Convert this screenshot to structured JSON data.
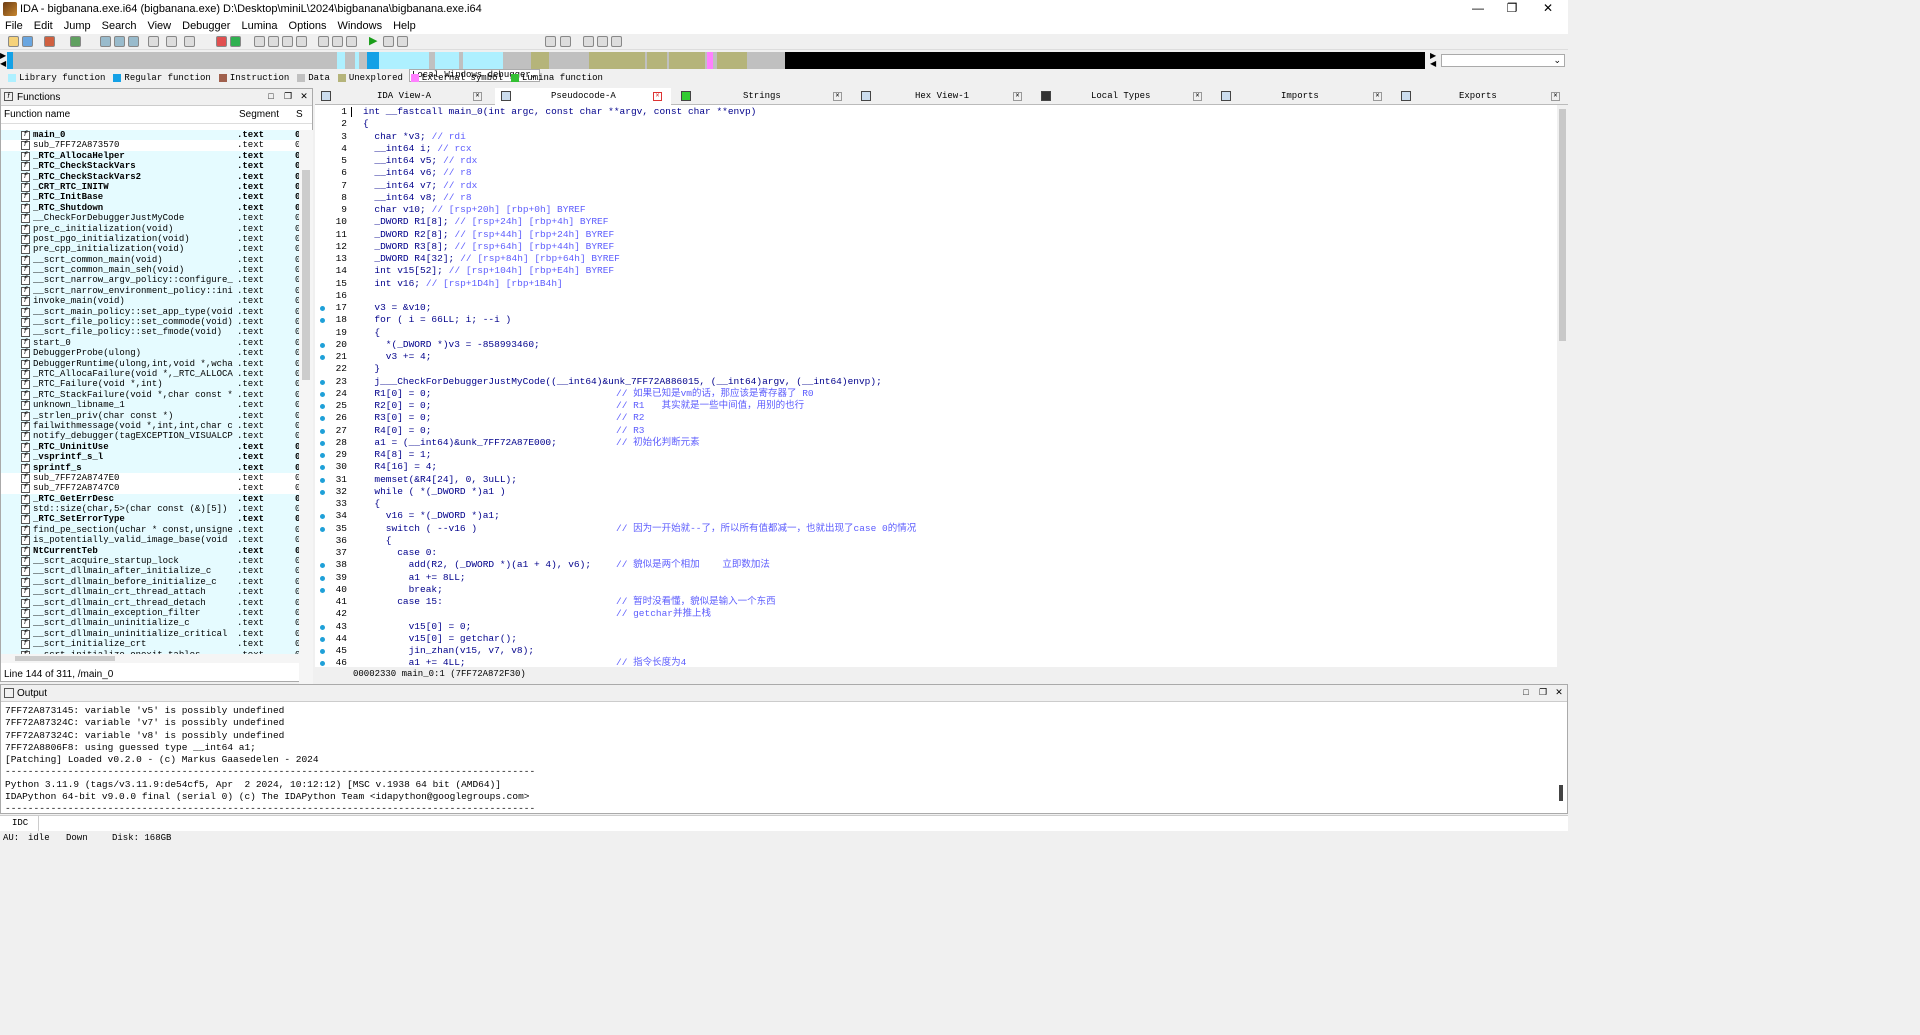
{
  "window": {
    "title": "IDA - bigbanana.exe.i64 (bigbanana.exe) D:\\Desktop\\miniL\\2024\\bigbanana\\bigbanana.exe.i64"
  },
  "menu": [
    "File",
    "Edit",
    "Jump",
    "Search",
    "View",
    "Debugger",
    "Lumina",
    "Options",
    "Windows",
    "Help"
  ],
  "toolbar": {
    "debugger": "Local Windows debugger"
  },
  "legend": [
    {
      "label": "Library function",
      "color": "#aef0ff"
    },
    {
      "label": "Regular function",
      "color": "#14a1e6"
    },
    {
      "label": "Instruction",
      "color": "#a0604d"
    },
    {
      "label": "Data",
      "color": "#c0c0c0"
    },
    {
      "label": "Unexplored",
      "color": "#b5b47a"
    },
    {
      "label": "External symbol",
      "color": "#ff80ff"
    },
    {
      "label": "Lumina function",
      "color": "#33c033"
    }
  ],
  "functions": {
    "title": "Functions",
    "col_name": "Function name",
    "col_segment": "Segment",
    "col_s": "S",
    "status": "Line 144 of 311, /main_0",
    "rows": [
      {
        "name": "main_0",
        "seg": ".text",
        "c": "0",
        "hl": true,
        "cy": true
      },
      {
        "name": "sub_7FF72A873570",
        "seg": ".text",
        "c": "0",
        "hl": false,
        "cy": false
      },
      {
        "name": "_RTC_AllocaHelper",
        "seg": ".text",
        "c": "0",
        "hl": true,
        "cy": true
      },
      {
        "name": "_RTC_CheckStackVars",
        "seg": ".text",
        "c": "0",
        "hl": true,
        "cy": true
      },
      {
        "name": "_RTC_CheckStackVars2",
        "seg": ".text",
        "c": "0",
        "hl": true,
        "cy": true
      },
      {
        "name": "_CRT_RTC_INITW",
        "seg": ".text",
        "c": "0",
        "hl": true,
        "cy": true
      },
      {
        "name": "_RTC_InitBase",
        "seg": ".text",
        "c": "0",
        "hl": true,
        "cy": true
      },
      {
        "name": "_RTC_Shutdown",
        "seg": ".text",
        "c": "0",
        "hl": true,
        "cy": true
      },
      {
        "name": "__CheckForDebuggerJustMyCode",
        "seg": ".text",
        "c": "0",
        "hl": false,
        "cy": true
      },
      {
        "name": "pre_c_initialization(void)",
        "seg": ".text",
        "c": "0",
        "hl": false,
        "cy": true
      },
      {
        "name": "post_pgo_initialization(void)",
        "seg": ".text",
        "c": "0",
        "hl": false,
        "cy": true
      },
      {
        "name": "pre_cpp_initialization(void)",
        "seg": ".text",
        "c": "0",
        "hl": false,
        "cy": true
      },
      {
        "name": "__scrt_common_main(void)",
        "seg": ".text",
        "c": "0",
        "hl": false,
        "cy": true
      },
      {
        "name": "__scrt_common_main_seh(void)",
        "seg": ".text",
        "c": "0",
        "hl": false,
        "cy": true
      },
      {
        "name": "__scrt_narrow_argv_policy::configure_a…",
        "seg": ".text",
        "c": "0",
        "hl": false,
        "cy": true
      },
      {
        "name": "__scrt_narrow_environment_policy::init…",
        "seg": ".text",
        "c": "0",
        "hl": false,
        "cy": true
      },
      {
        "name": "invoke_main(void)",
        "seg": ".text",
        "c": "0",
        "hl": false,
        "cy": true
      },
      {
        "name": "__scrt_main_policy::set_app_type(void)",
        "seg": ".text",
        "c": "0",
        "hl": false,
        "cy": true
      },
      {
        "name": "__scrt_file_policy::set_commode(void)",
        "seg": ".text",
        "c": "0",
        "hl": false,
        "cy": true
      },
      {
        "name": "__scrt_file_policy::set_fmode(void)",
        "seg": ".text",
        "c": "0",
        "hl": false,
        "cy": true
      },
      {
        "name": "start_0",
        "seg": ".text",
        "c": "0",
        "hl": false,
        "cy": true
      },
      {
        "name": "DebuggerProbe(ulong)",
        "seg": ".text",
        "c": "0",
        "hl": false,
        "cy": true
      },
      {
        "name": "DebuggerRuntime(ulong,int,void *,wchar…",
        "seg": ".text",
        "c": "0",
        "hl": false,
        "cy": true
      },
      {
        "name": "_RTC_AllocaFailure(void *,_RTC_ALLOCA_…",
        "seg": ".text",
        "c": "0",
        "hl": false,
        "cy": true
      },
      {
        "name": "_RTC_Failure(void *,int)",
        "seg": ".text",
        "c": "0",
        "hl": false,
        "cy": true
      },
      {
        "name": "_RTC_StackFailure(void *,char const *)",
        "seg": ".text",
        "c": "0",
        "hl": false,
        "cy": true
      },
      {
        "name": "unknown_libname_1",
        "seg": ".text",
        "c": "0",
        "hl": false,
        "cy": true
      },
      {
        "name": "_strlen_priv(char const *)",
        "seg": ".text",
        "c": "0",
        "hl": false,
        "cy": true
      },
      {
        "name": "failwithmessage(void *,int,int,char co…",
        "seg": ".text",
        "c": "0",
        "hl": false,
        "cy": true
      },
      {
        "name": "notify_debugger(tagEXCEPTION_VISUALCPP…",
        "seg": ".text",
        "c": "0",
        "hl": false,
        "cy": true
      },
      {
        "name": "_RTC_UninitUse",
        "seg": ".text",
        "c": "0",
        "hl": true,
        "cy": true
      },
      {
        "name": "_vsprintf_s_l",
        "seg": ".text",
        "c": "0",
        "hl": true,
        "cy": true
      },
      {
        "name": "sprintf_s",
        "seg": ".text",
        "c": "0",
        "hl": true,
        "cy": true
      },
      {
        "name": "sub_7FF72A8747E0",
        "seg": ".text",
        "c": "0",
        "hl": false,
        "cy": false
      },
      {
        "name": "sub_7FF72A8747C0",
        "seg": ".text",
        "c": "0",
        "hl": false,
        "cy": false
      },
      {
        "name": "_RTC_GetErrDesc",
        "seg": ".text",
        "c": "0",
        "hl": true,
        "cy": true
      },
      {
        "name": "std::size(char,5>(char const (&)[5])",
        "seg": ".text",
        "c": "0",
        "hl": false,
        "cy": true
      },
      {
        "name": "_RTC_SetErrorType",
        "seg": ".text",
        "c": "0",
        "hl": true,
        "cy": true
      },
      {
        "name": "find_pe_section(uchar * const,unsigned…",
        "seg": ".text",
        "c": "0",
        "hl": false,
        "cy": true
      },
      {
        "name": "is_potentially_valid_image_base(void *…",
        "seg": ".text",
        "c": "0",
        "hl": false,
        "cy": true
      },
      {
        "name": "NtCurrentTeb",
        "seg": ".text",
        "c": "0",
        "hl": true,
        "cy": true
      },
      {
        "name": "__scrt_acquire_startup_lock",
        "seg": ".text",
        "c": "0",
        "hl": false,
        "cy": true
      },
      {
        "name": "__scrt_dllmain_after_initialize_c",
        "seg": ".text",
        "c": "0",
        "hl": false,
        "cy": true
      },
      {
        "name": "__scrt_dllmain_before_initialize_c",
        "seg": ".text",
        "c": "0",
        "hl": false,
        "cy": true
      },
      {
        "name": "__scrt_dllmain_crt_thread_attach",
        "seg": ".text",
        "c": "0",
        "hl": false,
        "cy": true
      },
      {
        "name": "__scrt_dllmain_crt_thread_detach",
        "seg": ".text",
        "c": "0",
        "hl": false,
        "cy": true
      },
      {
        "name": "__scrt_dllmain_exception_filter",
        "seg": ".text",
        "c": "0",
        "hl": false,
        "cy": true
      },
      {
        "name": "__scrt_dllmain_uninitialize_c",
        "seg": ".text",
        "c": "0",
        "hl": false,
        "cy": true
      },
      {
        "name": "__scrt_dllmain_uninitialize_critical",
        "seg": ".text",
        "c": "0",
        "hl": false,
        "cy": true
      },
      {
        "name": "__scrt_initialize_crt",
        "seg": ".text",
        "c": "0",
        "hl": false,
        "cy": true
      },
      {
        "name": "__scrt_initialize_onexit_tables",
        "seg": ".text",
        "c": "0",
        "hl": false,
        "cy": true
      }
    ]
  },
  "tabs": [
    {
      "label": "IDA View-A",
      "active": false
    },
    {
      "label": "Pseudocode-A",
      "active": true
    },
    {
      "label": "Strings",
      "active": false
    },
    {
      "label": "Hex View-1",
      "active": false
    },
    {
      "label": "Local Types",
      "active": false
    },
    {
      "label": "Imports",
      "active": false
    },
    {
      "label": "Exports",
      "active": false
    }
  ],
  "code": {
    "status": "00002330 main_0:1 (7FF72A872F30)",
    "lines": [
      {
        "n": "1",
        "t": "int __fastcall main_0(int argc, const char **argv, const char **envp)",
        "c": "",
        "dot": false
      },
      {
        "n": "2",
        "t": "{",
        "c": "",
        "dot": false
      },
      {
        "n": "3",
        "t": "  char *v3; ",
        "c": "// rdi",
        "dot": false
      },
      {
        "n": "4",
        "t": "  __int64 i; ",
        "c": "// rcx",
        "dot": false
      },
      {
        "n": "5",
        "t": "  __int64 v5; ",
        "c": "// rdx",
        "dot": false
      },
      {
        "n": "6",
        "t": "  __int64 v6; ",
        "c": "// r8",
        "dot": false
      },
      {
        "n": "7",
        "t": "  __int64 v7; ",
        "c": "// rdx",
        "dot": false
      },
      {
        "n": "8",
        "t": "  __int64 v8; ",
        "c": "// r8",
        "dot": false
      },
      {
        "n": "9",
        "t": "  char v10; ",
        "c": "// [rsp+20h] [rbp+0h] BYREF",
        "dot": false
      },
      {
        "n": "10",
        "t": "  _DWORD R1[8]; ",
        "c": "// [rsp+24h] [rbp+4h] BYREF",
        "dot": false
      },
      {
        "n": "11",
        "t": "  _DWORD R2[8]; ",
        "c": "// [rsp+44h] [rbp+24h] BYREF",
        "dot": false
      },
      {
        "n": "12",
        "t": "  _DWORD R3[8]; ",
        "c": "// [rsp+64h] [rbp+44h] BYREF",
        "dot": false
      },
      {
        "n": "13",
        "t": "  _DWORD R4[32]; ",
        "c": "// [rsp+84h] [rbp+64h] BYREF",
        "dot": false
      },
      {
        "n": "14",
        "t": "  int v15[52]; ",
        "c": "// [rsp+104h] [rbp+E4h] BYREF",
        "dot": false
      },
      {
        "n": "15",
        "t": "  int v16; ",
        "c": "// [rsp+1D4h] [rbp+1B4h]",
        "dot": false
      },
      {
        "n": "16",
        "t": "",
        "c": "",
        "dot": false
      },
      {
        "n": "17",
        "t": "  v3 = &v10;",
        "c": "",
        "dot": true
      },
      {
        "n": "18",
        "t": "  for ( i = 66LL; i; --i )",
        "c": "",
        "dot": true
      },
      {
        "n": "19",
        "t": "  {",
        "c": "",
        "dot": false
      },
      {
        "n": "20",
        "t": "    *(_DWORD *)v3 = -858993460;",
        "c": "",
        "dot": true
      },
      {
        "n": "21",
        "t": "    v3 += 4;",
        "c": "",
        "dot": true
      },
      {
        "n": "22",
        "t": "  }",
        "c": "",
        "dot": false
      },
      {
        "n": "23",
        "t": "  j___CheckForDebuggerJustMyCode((__int64)&unk_7FF72A886015, (__int64)argv, (__int64)envp);",
        "c": "",
        "dot": true
      },
      {
        "n": "24",
        "t": "  R1[0] = 0;",
        "c": "// 如果已知是vm的话，那应该是寄存器了 R0",
        "dot": true
      },
      {
        "n": "25",
        "t": "  R2[0] = 0;",
        "c": "// R1   其实就是一些中间值，用别的也行",
        "dot": true
      },
      {
        "n": "26",
        "t": "  R3[0] = 0;",
        "c": "// R2",
        "dot": true
      },
      {
        "n": "27",
        "t": "  R4[0] = 0;",
        "c": "// R3",
        "dot": true
      },
      {
        "n": "28",
        "t": "  a1 = (__int64)&unk_7FF72A87E000;",
        "c": "// 初始化判断元素",
        "dot": true
      },
      {
        "n": "29",
        "t": "  R4[8] = 1;",
        "c": "",
        "dot": true
      },
      {
        "n": "30",
        "t": "  R4[16] = 4;",
        "c": "",
        "dot": true
      },
      {
        "n": "31",
        "t": "  memset(&R4[24], 0, 3uLL);",
        "c": "",
        "dot": true
      },
      {
        "n": "32",
        "t": "  while ( *(_DWORD *)a1 )",
        "c": "",
        "dot": true
      },
      {
        "n": "33",
        "t": "  {",
        "c": "",
        "dot": false
      },
      {
        "n": "34",
        "t": "    v16 = *(_DWORD *)a1;",
        "c": "",
        "dot": true
      },
      {
        "n": "35",
        "t": "    switch ( --v16 )",
        "c": "// 因为一开始就--了，所以所有值都减一，也就出现了case 0的情况",
        "dot": true
      },
      {
        "n": "36",
        "t": "    {",
        "c": "",
        "dot": false
      },
      {
        "n": "37",
        "t": "      case 0:",
        "c": "",
        "dot": false
      },
      {
        "n": "38",
        "t": "        add(R2, (_DWORD *)(a1 + 4), v6);",
        "c": "// 貌似是两个相加    立即数加法",
        "dot": true
      },
      {
        "n": "39",
        "t": "        a1 += 8LL;",
        "c": "",
        "dot": true
      },
      {
        "n": "40",
        "t": "        break;",
        "c": "",
        "dot": true
      },
      {
        "n": "41",
        "t": "      case 15:",
        "c": "// 暂时没看懂，貌似是输入一个东西",
        "dot": false
      },
      {
        "n": "42",
        "t": "",
        "c": "// getchar并推上栈",
        "dot": false
      },
      {
        "n": "43",
        "t": "        v15[0] = 0;",
        "c": "",
        "dot": true
      },
      {
        "n": "44",
        "t": "        v15[0] = getchar();",
        "c": "",
        "dot": true
      },
      {
        "n": "45",
        "t": "        jin_zhan(v15, v7, v8);",
        "c": "",
        "dot": true
      },
      {
        "n": "46",
        "t": "        a1 += 4LL;",
        "c": "// 指令长度为4",
        "dot": true
      }
    ]
  },
  "output": {
    "title": "Output",
    "lines": [
      "7FF72A873145: variable 'v5' is possibly undefined",
      "7FF72A87324C: variable 'v7' is possibly undefined",
      "7FF72A87324C: variable 'v8' is possibly undefined",
      "7FF72A8806F8: using guessed type __int64 a1;",
      "[Patching] Loaded v0.2.0 - (c) Markus Gaasedelen - 2024",
      "---------------------------------------------------------------------------------------------",
      "Python 3.11.9 (tags/v3.11.9:de54cf5, Apr  2 2024, 10:12:12) [MSC v.1938 64 bit (AMD64)]",
      "IDAPython 64-bit v9.0.0 final (serial 0) (c) The IDAPython Team <idapython@googlegroups.com>",
      "---------------------------------------------------------------------------------------------"
    ]
  },
  "idc": {
    "label": "IDC"
  },
  "status": {
    "au": "AU:",
    "state": "idle",
    "dir": "Down",
    "disk": "Disk: 168GB"
  }
}
